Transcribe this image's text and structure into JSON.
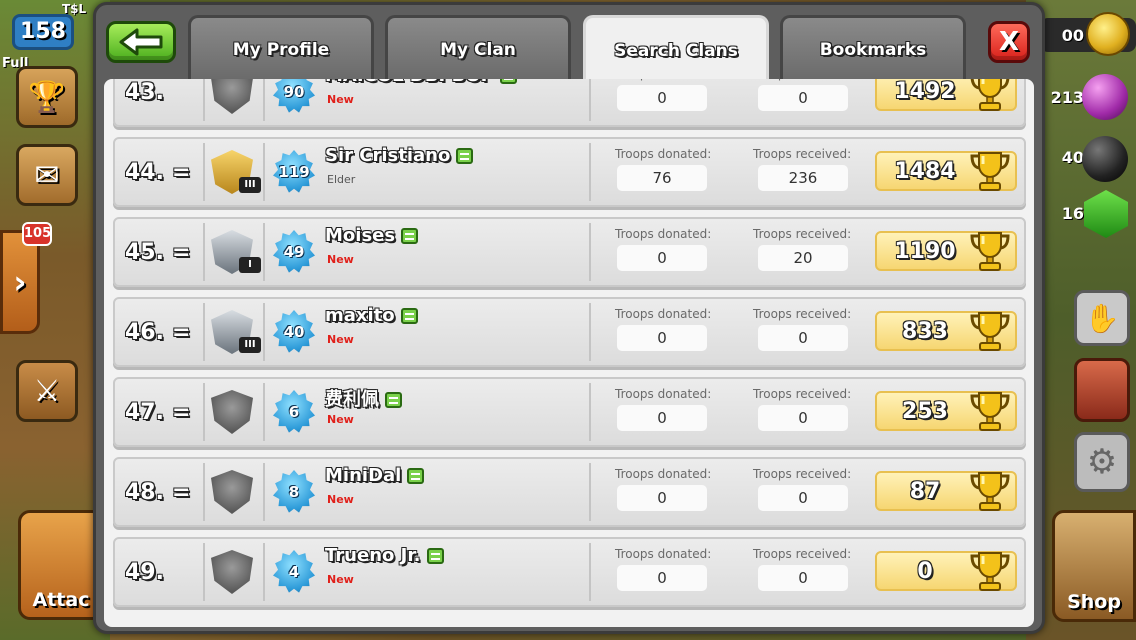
{
  "hud": {
    "level": "158",
    "player_name": "T$L",
    "full_label": "Full",
    "messages_badge": "105",
    "attack_label": "Attac",
    "shop_label": "Shop",
    "gold_suffix": "00",
    "elixir_suffix": "213",
    "dark_suffix": "40",
    "gems_suffix": "16"
  },
  "tabs": {
    "profile": "My Profile",
    "my_clan": "My Clan",
    "search_clans": "Search Clans",
    "bookmarks": "Bookmarks",
    "close": "X"
  },
  "labels": {
    "troops_donated": "Troops donated:",
    "troops_received": "Troops received:"
  },
  "members": [
    {
      "rank": "43.",
      "change": "",
      "level": "90",
      "name": "MAICOL DBPBOP",
      "role": "New",
      "league": "unranked",
      "tier": "",
      "donated": "0",
      "received": "0",
      "trophies": "1492"
    },
    {
      "rank": "44.",
      "change": "=",
      "level": "119",
      "name": "Sir Cristiano",
      "role": "Elder",
      "league": "gold",
      "tier": "III",
      "donated": "76",
      "received": "236",
      "trophies": "1484"
    },
    {
      "rank": "45.",
      "change": "=",
      "level": "49",
      "name": "Moises",
      "role": "New",
      "league": "silver",
      "tier": "I",
      "donated": "0",
      "received": "20",
      "trophies": "1190"
    },
    {
      "rank": "46.",
      "change": "=",
      "level": "40",
      "name": "maxito",
      "role": "New",
      "league": "silver",
      "tier": "III",
      "donated": "0",
      "received": "0",
      "trophies": "833"
    },
    {
      "rank": "47.",
      "change": "=",
      "level": "6",
      "name": "费利佩",
      "role": "New",
      "league": "unranked",
      "tier": "",
      "donated": "0",
      "received": "0",
      "trophies": "253"
    },
    {
      "rank": "48.",
      "change": "=",
      "level": "8",
      "name": "MiniDal",
      "role": "New",
      "league": "unranked",
      "tier": "",
      "donated": "0",
      "received": "0",
      "trophies": "87"
    },
    {
      "rank": "49.",
      "change": "",
      "level": "4",
      "name": "Trueno Jr.",
      "role": "New",
      "league": "unranked",
      "tier": "",
      "donated": "0",
      "received": "0",
      "trophies": "0"
    }
  ]
}
